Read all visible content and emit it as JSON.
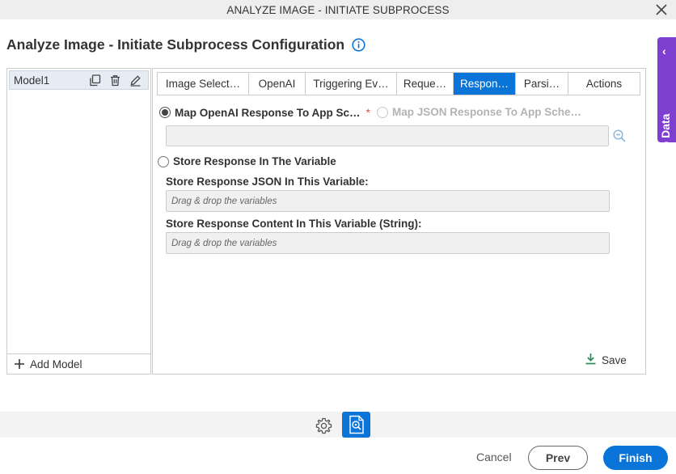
{
  "window": {
    "title": "ANALYZE IMAGE - INITIATE SUBPROCESS",
    "close_icon": "close-icon"
  },
  "heading": {
    "title": "Analyze Image - Initiate Subprocess Configuration",
    "info_icon": "info-icon"
  },
  "app_data": {
    "label": "App Data",
    "chevron": "‹",
    "color": "#7e3ecf"
  },
  "models": {
    "items": [
      {
        "name": "Model1"
      }
    ],
    "add_label": "Add Model"
  },
  "tabs": [
    {
      "label": "Image Select…",
      "active": false
    },
    {
      "label": "OpenAI",
      "active": false
    },
    {
      "label": "Triggering Ev…",
      "active": false
    },
    {
      "label": "Reque…",
      "active": false
    },
    {
      "label": "Respon…",
      "active": true
    },
    {
      "label": "Parsi…",
      "active": false
    },
    {
      "label": "Actions",
      "active": false
    }
  ],
  "response": {
    "option_map_openai": "Map OpenAI Response To App Sc…",
    "required_mark": "*",
    "option_map_json": "Map JSON Response To App Sche…",
    "option_store": "Store Response In The Variable",
    "json_var_label": "Store Response JSON In This Variable:",
    "json_var_placeholder": "Drag & drop the variables",
    "content_var_label": "Store Response Content In This Variable (String):",
    "content_var_placeholder": "Drag & drop the variables",
    "save_label": "Save"
  },
  "footer": {
    "cancel_label": "Cancel",
    "prev_label": "Prev",
    "finish_label": "Finish"
  },
  "colors": {
    "accent": "#0a74d9",
    "app_data": "#7e3ecf",
    "required": "#d9534f",
    "save_icon": "#2e8b57"
  }
}
